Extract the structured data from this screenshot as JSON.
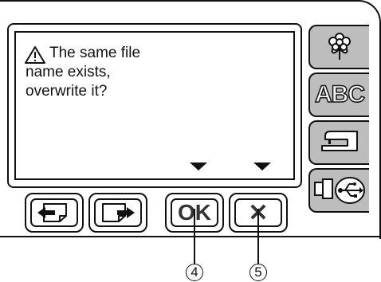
{
  "dialog": {
    "line1": "The same file",
    "line2": "name exists,",
    "line3": "overwrite it?",
    "icon": "warning-triangle-icon"
  },
  "buttons": {
    "prev_icon": "page-back-icon",
    "next_icon": "page-forward-icon",
    "ok_label": "OK",
    "cancel_label": "✕"
  },
  "side_tabs": [
    {
      "name": "flower-pattern-tab",
      "icon": "flower-icon"
    },
    {
      "name": "abc-letters-tab",
      "label": "ABC"
    },
    {
      "name": "sewing-machine-tab",
      "icon": "sewing-machine-icon"
    },
    {
      "name": "usb-tab",
      "icon": "usb-icon"
    }
  ],
  "callouts": {
    "ok": "4",
    "cancel": "5"
  },
  "colors": {
    "tab_fill": "#bdbdbd",
    "line": "#111111"
  }
}
